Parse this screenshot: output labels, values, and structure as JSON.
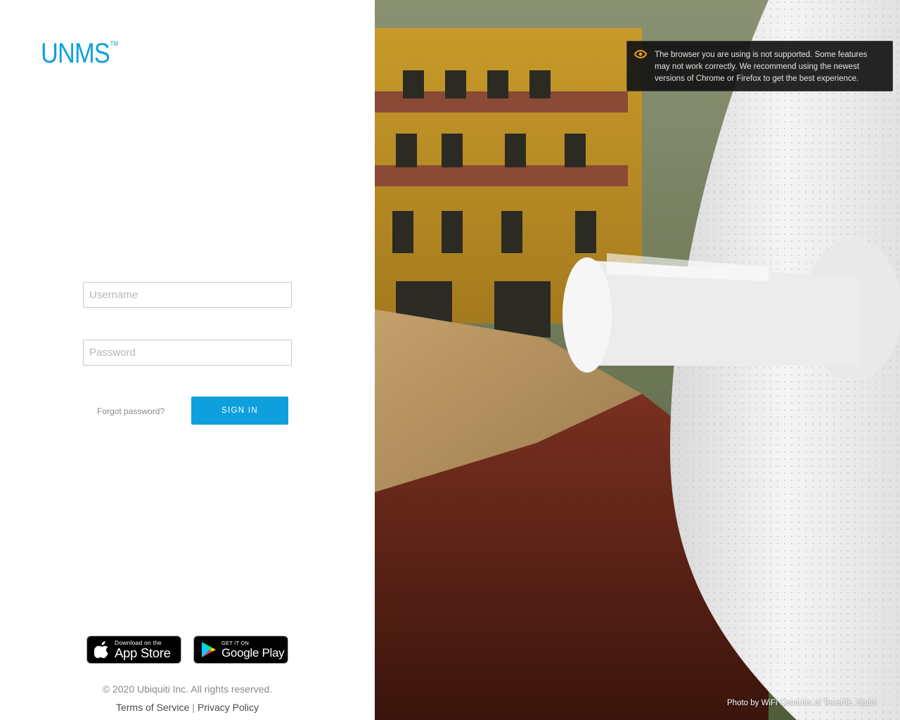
{
  "brand": {
    "logo_text": "UNMS",
    "trademark": "TM",
    "accent_color": "#0ea0dd"
  },
  "login": {
    "username_placeholder": "Username",
    "password_placeholder": "Password",
    "forgot_label": "Forgot password?",
    "signin_label": "SIGN IN"
  },
  "stores": {
    "apple": {
      "small": "Download on the",
      "big": "App Store",
      "icon": "apple-icon"
    },
    "google": {
      "small": "GET IT ON",
      "big": "Google Play",
      "icon": "google-play-icon"
    }
  },
  "footer": {
    "copyright": "© 2020 Ubiquiti Inc. All rights reserved.",
    "terms": "Terms of Service",
    "separator": "|",
    "privacy": "Privacy Policy"
  },
  "warning": {
    "icon": "eye-icon",
    "icon_color": "#f0a020",
    "message": "The browser you are using is not supported. Some features may not work correctly. We recommend using the newest versions of Chrome or Firefox to get the best experience."
  },
  "photo": {
    "credit": "Photo by WiFi Canarias at Tenerife, Spain"
  }
}
